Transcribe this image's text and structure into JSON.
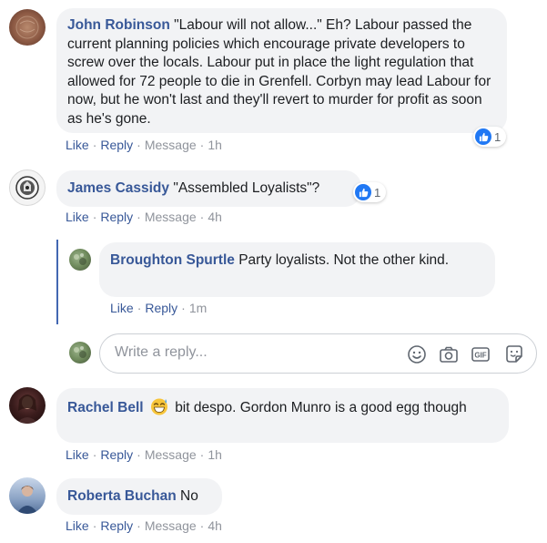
{
  "comments": [
    {
      "author": "John Robinson",
      "text": "\"Labour will not allow...\" Eh? Labour passed the current planning policies which encourage private developers to screw over the locals. Labour put in place the light regulation that allowed for 72 people to die in Grenfell. Corbyn may lead Labour for now, but he won't last and they'll revert to murder for profit as soon as he's gone.",
      "actions": {
        "like": "Like",
        "reply": "Reply",
        "message": "Message",
        "time": "1h"
      },
      "reaction_count": "1"
    },
    {
      "author": "James Cassidy",
      "text": "\"Assembled Loyalists\"?",
      "actions": {
        "like": "Like",
        "reply": "Reply",
        "message": "Message",
        "time": "4h"
      },
      "reaction_count": "1"
    },
    {
      "author": "Rachel Bell",
      "text": "bit despo. Gordon Munro is a good egg though",
      "actions": {
        "like": "Like",
        "reply": "Reply",
        "message": "Message",
        "time": "1h"
      }
    },
    {
      "author": "Roberta Buchan",
      "text": "No",
      "actions": {
        "like": "Like",
        "reply": "Reply",
        "message": "Message",
        "time": "4h"
      }
    }
  ],
  "reply": {
    "author": "Broughton Spurtle",
    "text": "Party loyalists. Not the other kind.",
    "actions": {
      "like": "Like",
      "reply": "Reply",
      "time": "1m"
    }
  },
  "reply_input": {
    "placeholder": "Write a reply..."
  },
  "input_icons": [
    "emoji-icon",
    "camera-icon",
    "gif-icon",
    "sticker-icon"
  ],
  "colors": {
    "link": "#385898",
    "bubble": "#f2f3f5",
    "muted": "#90949c",
    "like_blue": "#2078f4",
    "thread_line": "#4267b2"
  }
}
